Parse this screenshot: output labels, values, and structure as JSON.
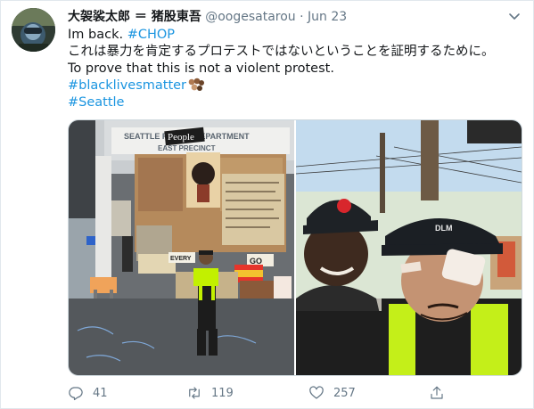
{
  "tweet": {
    "display_name": "大袈裟太郎 ＝ 猪股東吾",
    "handle": "@oogesatarou",
    "separator": "·",
    "date": "Jun 23",
    "line1_text": "Im back. ",
    "line1_hashtag": "#CHOP",
    "line2": "これは暴力を肯定するプロテストではないということを証明するために。",
    "line3": "To prove that this is not a violent protest.",
    "hashtag1": "#blacklivesmatter",
    "hashtag2": "#Seattle",
    "emoji": "fist-emoji-multiple-skin-tones"
  },
  "media": {
    "photo1_sign_top": "SEATTLE POLICE DEPARTMENT",
    "photo1_sign_overlay": "People",
    "photo1_sign_bottom": "EAST PRECINCT",
    "photo1_sign_left": "EVERY",
    "photo1_sign_right": "GO",
    "photo2_hat": "DLM"
  },
  "actions": {
    "reply_count": "41",
    "retweet_count": "119",
    "like_count": "257"
  },
  "colors": {
    "link": "#1b95e0",
    "muted": "#657786",
    "border": "#e1e8ed"
  }
}
